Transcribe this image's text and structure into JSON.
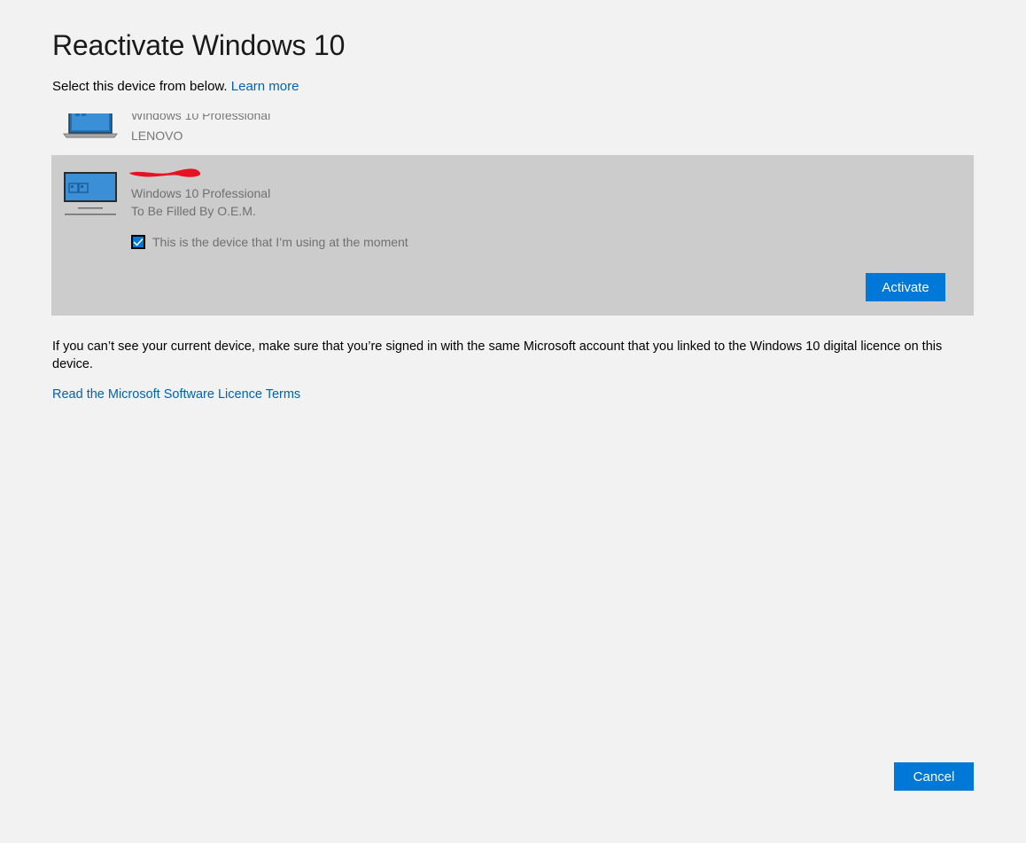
{
  "page": {
    "title": "Reactivate Windows 10",
    "subtitle": "Select this device from below.",
    "learn_more": "Learn more"
  },
  "devices": [
    {
      "os": "Windows 10 Professional",
      "manufacturer": "LENOVO",
      "icon": "laptop-icon"
    },
    {
      "os": "Windows 10 Professional",
      "manufacturer": "To Be Filled By O.E.M.",
      "icon": "desktop-monitor-icon",
      "current_device_label": "This is the device that I’m using at the moment",
      "current_device_checked": true,
      "activate_label": "Activate"
    }
  ],
  "info_text": "If you can’t see your current device, make sure that you’re signed in with the same Microsoft account that you linked to the Windows 10 digital licence on this device.",
  "terms_link": "Read the Microsoft Software Licence Terms",
  "cancel_label": "Cancel",
  "colors": {
    "accent": "#0078d7",
    "link": "#0063b1",
    "selected_bg": "#cccccc",
    "background": "#f2f2f2",
    "redaction": "#e81123"
  }
}
